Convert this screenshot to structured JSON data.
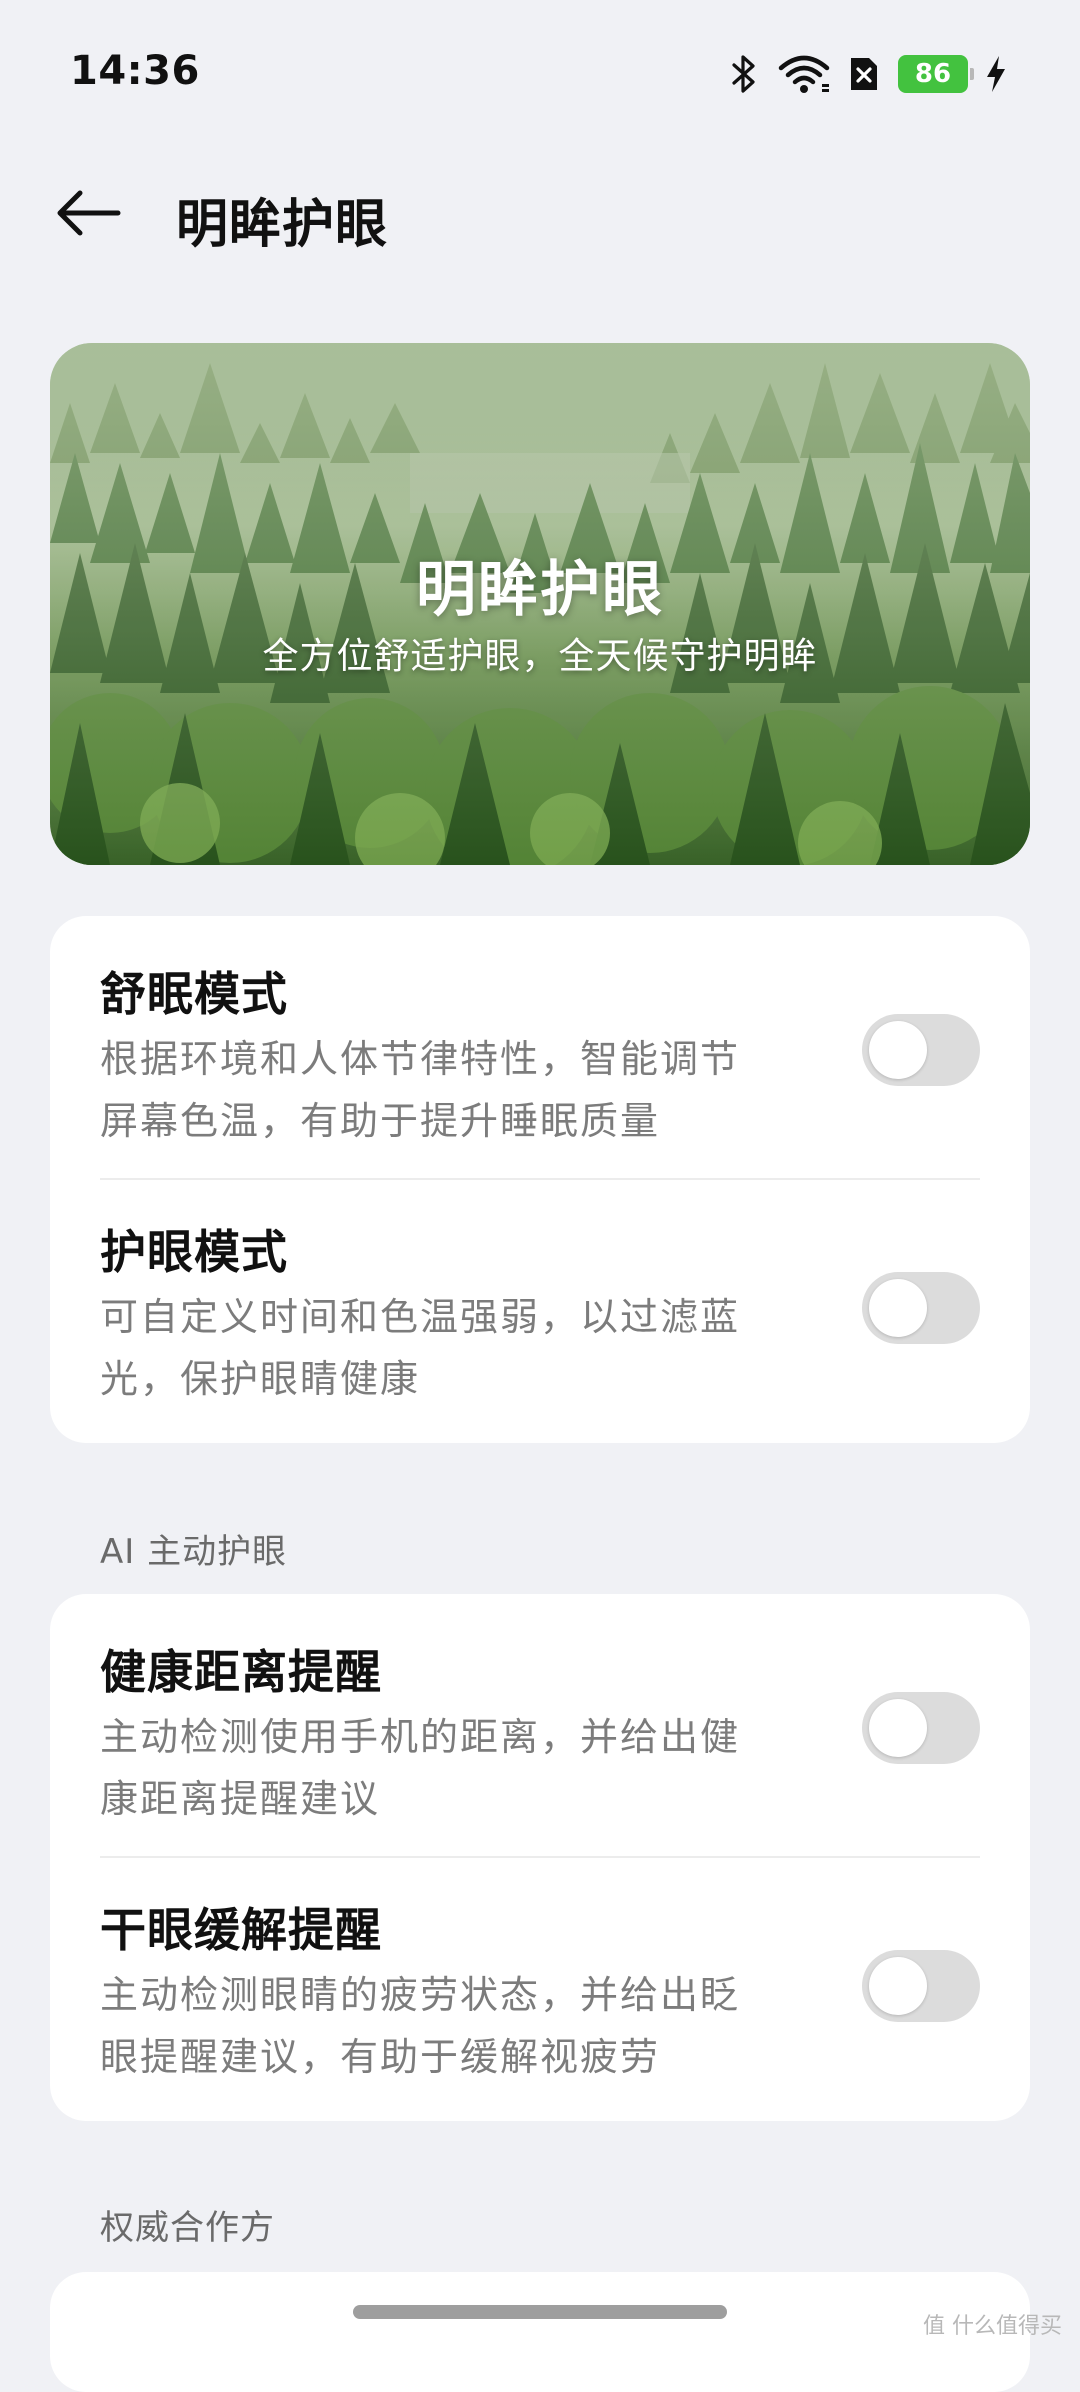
{
  "status_bar": {
    "time": "14:36",
    "battery": "86",
    "icons": [
      "bluetooth-icon",
      "wifi-icon",
      "sim-off-icon",
      "battery-icon",
      "charging-icon"
    ]
  },
  "header": {
    "title": "明眸护眼",
    "back_icon": "arrow-left-icon"
  },
  "banner": {
    "title": "明眸护眼",
    "subtitle": "全方位舒适护眼，全天候守护明眸"
  },
  "settings": [
    {
      "title": "舒眠模式",
      "desc_line1": "根据环境和人体节律特性，智能调节",
      "desc_line2": "屏幕色温，有助于提升睡眠质量",
      "enabled": false
    },
    {
      "title": "护眼模式",
      "desc_line1": "可自定义时间和色温强弱，以过滤蓝",
      "desc_line2": "光，保护眼睛健康",
      "enabled": false
    }
  ],
  "ai_section": {
    "label": "AI 主动护眼",
    "items": [
      {
        "title": "健康距离提醒",
        "desc_line1": "主动检测使用手机的距离，并给出健",
        "desc_line2": "康距离提醒建议",
        "enabled": false
      },
      {
        "title": "干眼缓解提醒",
        "desc_line1": "主动检测眼睛的疲劳状态，并给出眨",
        "desc_line2": "眼提醒建议，有助于缓解视疲劳",
        "enabled": false
      }
    ]
  },
  "partners_section": {
    "label": "权威合作方"
  },
  "watermark": "值 什么值得买",
  "colors": {
    "background": "#f0f1f5",
    "card": "#ffffff",
    "toggle_off": "#dcdcdc",
    "battery": "#43c23f"
  }
}
